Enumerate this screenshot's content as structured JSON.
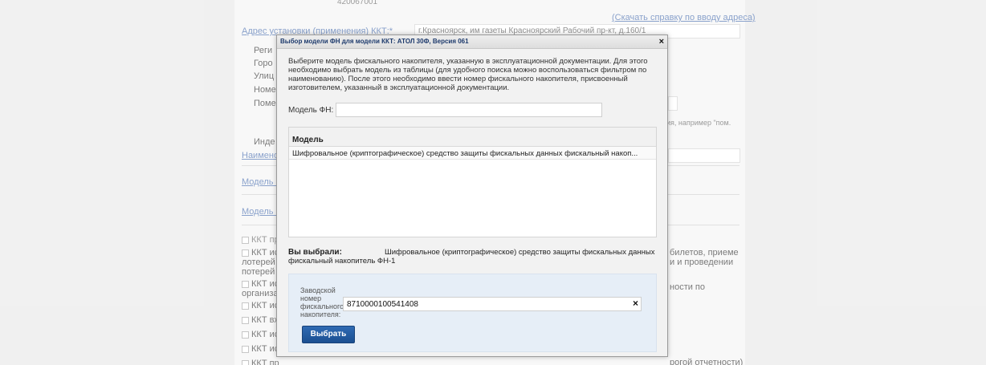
{
  "background_form": {
    "top_value": "420067001",
    "help_link": "(Скачать справку по вводу адреса)",
    "address_label": "Адрес установки (применения) ККТ:*",
    "address_value": "г.Красноярск, им газеты Красноярский Рабочий пр-кт, д.160/1",
    "region_label": "Реги",
    "city_label": "Горо",
    "street_label": "Улиц",
    "house_label": "Номе",
    "room_label": "Поме",
    "room_hint": "ия, например \"пом.",
    "index_label": "Инде",
    "name_label": "Наимено",
    "kkt_model_label": "Модель К",
    "fn_model_label": "Модель Ф",
    "checkboxes": [
      {
        "label": "ККТ пр"
      },
      {
        "label": "ККТ ис",
        "label2": "лотерей",
        "label3": "потерей",
        "right": "билетов, приеме",
        "right2": "и и проведении"
      },
      {
        "label": "ККТ ис",
        "label2": "организа",
        "right": "ности по"
      },
      {
        "label": "ККТ ис"
      },
      {
        "label": "ККТ вх"
      },
      {
        "label": "ККТ ис"
      },
      {
        "label": "ККТ ис"
      },
      {
        "label": "ККТ пр",
        "right": "рогой отчетности)"
      }
    ]
  },
  "modal": {
    "title": "Выбор модели ФН для модели ККТ: АТОЛ 30Ф, Версия 061",
    "close": "×",
    "instructions": "Выберите модель фискального накопителя, указанную в эксплуатационной документации. Для этого необходимо выбрать модель из таблицы (для удобного поиска можно воспользоваться фильтром по наименованию). После этого необходимо ввести номер фискального накопителя, присвоенный изготовителем, указанный в эксплуатационной документации.",
    "filter_label": "Модель ФН:",
    "filter_value": "",
    "grid": {
      "header": "Модель",
      "rows": [
        "Шифровальное (криптографическое) средство защиты фискальных данных фискальный накоп..."
      ]
    },
    "chosen_label": "Вы выбрали:",
    "chosen_value": "Шифровальное (криптографическое) средство защиты фискальных данных фискальный накопитель ФН-1",
    "serial_label": "Заводской номер фискального накопителя:",
    "serial_value": "8710000100541408",
    "serial_clear": "×",
    "select_button": "Выбрать"
  }
}
